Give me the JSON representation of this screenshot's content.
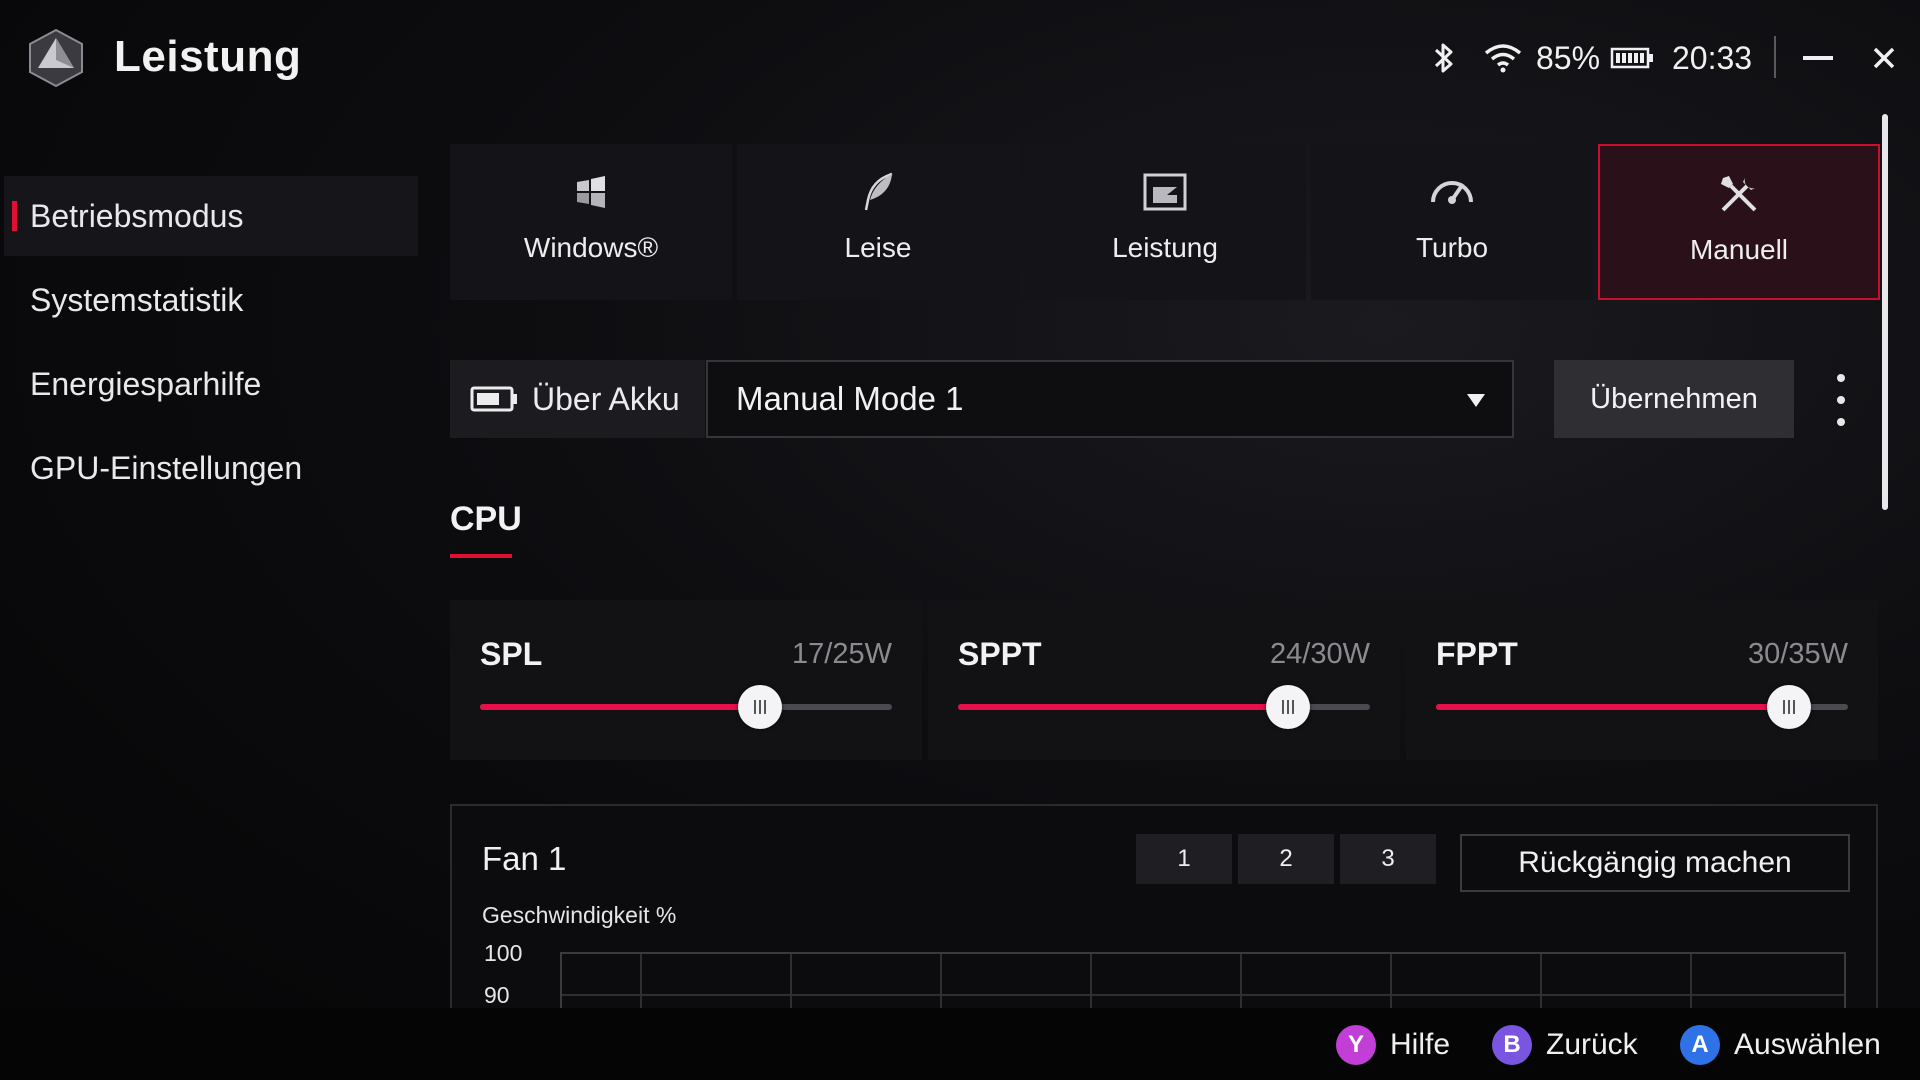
{
  "app": {
    "title": "Leistung",
    "logo_icon": "rog-ally-logo"
  },
  "status": {
    "bluetooth_icon": "bluetooth-icon",
    "wifi_icon": "wifi-icon",
    "battery_percent": "85%",
    "battery_icon": "battery-icon",
    "time": "20:33"
  },
  "window": {
    "minimize_icon": "minimize-icon",
    "close_icon": "close-icon"
  },
  "sidebar": {
    "items": [
      {
        "label": "Betriebsmodus",
        "active": true
      },
      {
        "label": "Systemstatistik"
      },
      {
        "label": "Energiesparhilfe"
      },
      {
        "label": "GPU-Einstellungen"
      }
    ]
  },
  "modes": [
    {
      "label": "Windows®",
      "icon": "windows-icon"
    },
    {
      "label": "Leise",
      "icon": "feather-icon"
    },
    {
      "label": "Leistung",
      "icon": "performance-icon"
    },
    {
      "label": "Turbo",
      "icon": "speedometer-icon"
    },
    {
      "label": "Manuell",
      "icon": "tools-icon",
      "active": true
    }
  ],
  "profile": {
    "power_source_label": "Über Akku",
    "selected_mode": "Manual Mode 1",
    "apply_label": "Übernehmen"
  },
  "cpu": {
    "tab_label": "CPU",
    "sliders": [
      {
        "name": "SPL",
        "value": 17,
        "max": 25,
        "display": "17/25W"
      },
      {
        "name": "SPPT",
        "value": 24,
        "max": 30,
        "display": "24/30W"
      },
      {
        "name": "FPPT",
        "value": 30,
        "max": 35,
        "display": "30/35W"
      }
    ]
  },
  "fan": {
    "title": "Fan 1",
    "presets": [
      "1",
      "2",
      "3"
    ],
    "undo_label": "Rückgängig machen",
    "y_label": "Geschwindigkeit %",
    "y_ticks": [
      "100",
      "90"
    ]
  },
  "footer": {
    "hints": [
      {
        "button": "Y",
        "label": "Hilfe",
        "color": "#c13fd6"
      },
      {
        "button": "B",
        "label": "Zurück",
        "color": "#7a55e0"
      },
      {
        "button": "A",
        "label": "Auswählen",
        "color": "#2f72e8"
      }
    ]
  },
  "colors": {
    "accent": "#e01032",
    "active_tile_bg": "#2a1119"
  }
}
